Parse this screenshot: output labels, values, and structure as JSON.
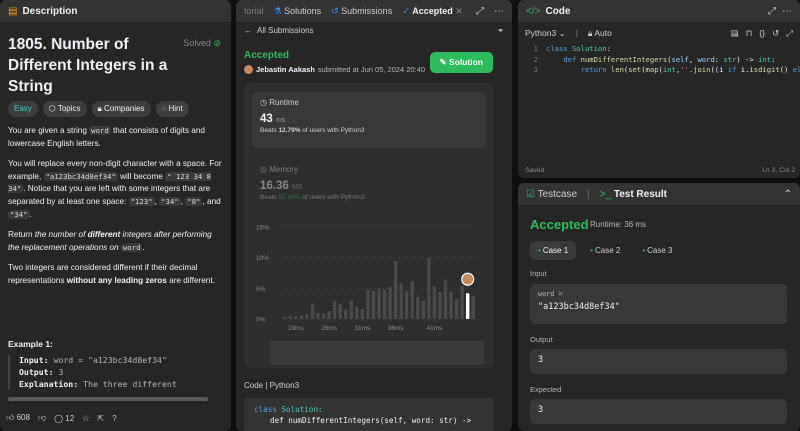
{
  "description": {
    "tab_label": "Description",
    "title": "1805. Number of Different Integers in a String",
    "solved_label": "Solved",
    "tags": [
      "Easy",
      "Topics",
      "Companies",
      "Hint"
    ],
    "p1_a": "You are given a string ",
    "p1_code": "word",
    "p1_b": " that consists of digits and lowercase English letters.",
    "p2_a": "You will replace every non-digit character with a space. For example, ",
    "p2_code1": "\"a123bc34d8ef34\"",
    "p2_b": " will become ",
    "p2_code2": "\" 123  34 8  34\"",
    "p2_c": ". Notice that you are left with some integers that are separated by at least one space: ",
    "p2_code3": "\"123\"",
    "p2_code4": "\"34\"",
    "p2_code5": "\"8\"",
    "p2_and": ", and ",
    "p2_code6": "\"34\"",
    "p3_a": "Return ",
    "p3_em1": "the number of ",
    "p3_strong": "different",
    "p3_em2": " integers after performing the replacement operations on ",
    "p3_code": "word",
    "p4_a": "Two integers are considered different if their decimal representations ",
    "p4_strong": "without any leading zeros",
    "p4_b": " are different.",
    "example_title": "Example 1:",
    "ex_input_label": "Input:",
    "ex_input_value": "word = \"a123bc34d8ef34\"",
    "ex_output_label": "Output:",
    "ex_output_value": "3",
    "ex_expl_label": "Explanation:",
    "ex_expl_value": "The three different",
    "likes": "608",
    "comments": "12"
  },
  "submissions": {
    "tab_partial": "torial",
    "tab_solutions": "Solutions",
    "tab_submissions": "Submissions",
    "tab_accepted": "Accepted",
    "back_label": "All Submissions",
    "status": "Accepted",
    "author": "Jebastin Aakash",
    "submitted_text": "submitted at Jun 05, 2024 20:40",
    "solution_button": "Solution",
    "runtime_label": "Runtime",
    "runtime_value": "43",
    "runtime_unit": "ms",
    "beats_prefix": "Beats",
    "runtime_beats": "12.79%",
    "beats_suffix": "of users with Python3",
    "memory_label": "Memory",
    "memory_value": "16.36",
    "memory_unit": "MB",
    "memory_beats": "97.48%",
    "code_label": "Code",
    "code_lang": "Python3",
    "code_line1_kw": "class",
    "code_line1_cls": "Solution:",
    "code_line2": "def numDifferentIntegers(self, word: str) ->"
  },
  "chart_data": {
    "type": "bar",
    "yticks": [
      "15%",
      "10%",
      "5%",
      "0%"
    ],
    "ylim": [
      0,
      15
    ],
    "xticks": [
      "19ms",
      "26ms",
      "31ms",
      "36ms",
      "41ms"
    ],
    "values": [
      0.3,
      0.5,
      0.4,
      0.6,
      0.8,
      2.5,
      1.0,
      0.9,
      1.3,
      3.0,
      2.4,
      1.5,
      3.0,
      2.0,
      1.6,
      4.8,
      4.6,
      5.0,
      4.8,
      5.2,
      9.5,
      5.8,
      4.6,
      6.2,
      3.6,
      3.0,
      10.0,
      5.3,
      4.4,
      6.4,
      4.5,
      3.3,
      5.4,
      4.2,
      3.8
    ],
    "highlight_index": 33
  },
  "code": {
    "tab_label": "Code",
    "language": "Python3",
    "mode": "Auto",
    "lines": [
      "class Solution:",
      "    def numDifferentIntegers(self, word: str) -> int:",
      "        return len(set(map(int,''.join((i if i.isdigit() el"
    ],
    "saved": "Saved",
    "cursor": "Ln 3, Col 2"
  },
  "test": {
    "testcase_tab": "Testcase",
    "result_tab": "Test Result",
    "status": "Accepted",
    "runtime": "Runtime: 36 ms",
    "cases": [
      "Case 1",
      "Case 2",
      "Case 3"
    ],
    "input_label": "Input",
    "input_var": "word =",
    "input_value": "\"a123bc34d8ef34\"",
    "output_label": "Output",
    "output_value": "3",
    "expected_label": "Expected",
    "expected_value": "3"
  }
}
